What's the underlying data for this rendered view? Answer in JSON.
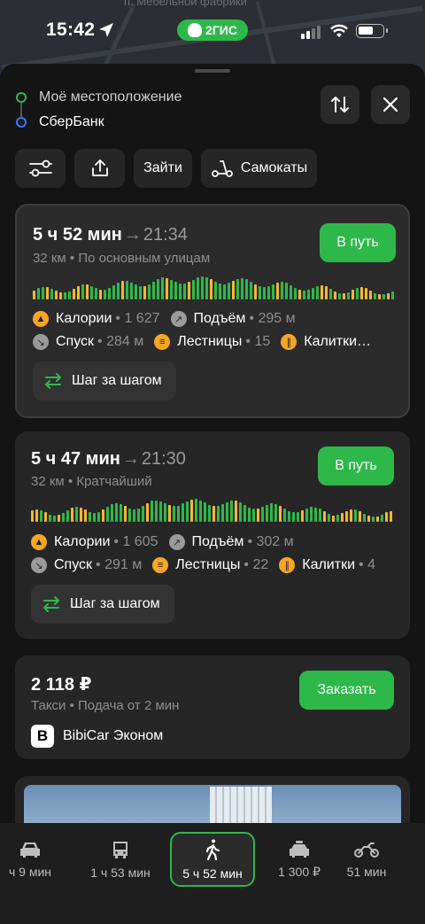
{
  "map": {
    "label": "п. Мебельной фабрики"
  },
  "status_bar": {
    "time": "15:42",
    "app_badge": "2ГИС"
  },
  "route": {
    "from": "Моё местоположение",
    "to": "СберБанк"
  },
  "chips": {
    "login": "Зайти",
    "scooters": "Самокаты"
  },
  "routes": [
    {
      "duration": "5 ч 52 мин",
      "arrival": "21:34",
      "arrow": "→",
      "summary": "32 км • По основным улицам",
      "go_label": "В путь",
      "facts": {
        "calories_label": "Калории",
        "calories": "• 1 627",
        "ascent_label": "Подъём",
        "ascent": "• 295 м",
        "descent_label": "Спуск",
        "descent": "• 284 м",
        "stairs_label": "Лестницы",
        "stairs": "• 15",
        "gates_label": "Калитки…",
        "gates": ""
      },
      "step_label": "Шаг за шагом"
    },
    {
      "duration": "5 ч 47 мин",
      "arrival": "21:30",
      "arrow": "→",
      "summary": "32 км • Кратчайший",
      "go_label": "В путь",
      "facts": {
        "calories_label": "Калории",
        "calories": "• 1 605",
        "ascent_label": "Подъём",
        "ascent": "• 302 м",
        "descent_label": "Спуск",
        "descent": "• 291 м",
        "stairs_label": "Лестницы",
        "stairs": "• 22",
        "gates_label": "Калитки",
        "gates": "• 4"
      },
      "step_label": "Шаг за шагом"
    }
  ],
  "taxi": {
    "price": "2 118 ₽",
    "summary": "Такси • Подача от 2 мин",
    "order_label": "Заказать",
    "provider": "BibiCar Эконом",
    "provider_logo": "B"
  },
  "modes": [
    {
      "icon": "car-icon",
      "label": "ч 9 мин"
    },
    {
      "icon": "bus-icon",
      "label": "1 ч 53 мин"
    },
    {
      "icon": "walk-icon",
      "label": "5 ч 52 мин",
      "active": true
    },
    {
      "icon": "taxi-icon",
      "label": "1 300 ₽"
    },
    {
      "icon": "motorbike-icon",
      "label": "51 мин"
    }
  ],
  "colors": {
    "accent": "#2fb84a",
    "from_dot": "#2fb84a",
    "to_dot": "#2f7cf6",
    "bar_green": "#2fb84a",
    "bar_yellow": "#f5b731"
  }
}
